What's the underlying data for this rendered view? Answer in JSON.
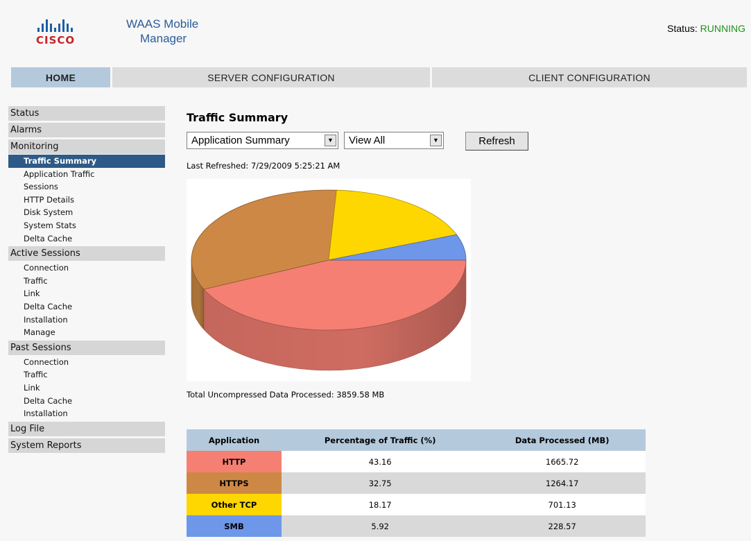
{
  "header": {
    "logo_text": "CISCO",
    "app_title_line1": "WAAS Mobile",
    "app_title_line2": "Manager",
    "status_label": "Status:",
    "status_value": "RUNNING",
    "status_color": "#1e8f1e"
  },
  "topnav": [
    {
      "label": "HOME",
      "active": true
    },
    {
      "label": "SERVER CONFIGURATION",
      "active": false
    },
    {
      "label": "CLIENT CONFIGURATION",
      "active": false
    }
  ],
  "sidebar": {
    "status": "Status",
    "alarms": "Alarms",
    "monitoring": {
      "label": "Monitoring",
      "items": [
        "Traffic Summary",
        "Application Traffic",
        "Sessions",
        "HTTP Details",
        "Disk System",
        "System Stats",
        "Delta Cache"
      ]
    },
    "active_sessions": {
      "label": "Active Sessions",
      "items": [
        "Connection",
        "Traffic",
        "Link",
        "Delta Cache",
        "Installation",
        "Manage"
      ]
    },
    "past_sessions": {
      "label": "Past Sessions",
      "items": [
        "Connection",
        "Traffic",
        "Link",
        "Delta Cache",
        "Installation"
      ]
    },
    "log_file": "Log File",
    "system_reports": "System Reports"
  },
  "main": {
    "title": "Traffic Summary",
    "select_view": "Application Summary",
    "select_filter": "View All",
    "refresh_label": "Refresh",
    "last_refreshed": "Last Refreshed: 7/29/2009 5:25:21 AM",
    "total": "Total Uncompressed Data Processed: 3859.58 MB",
    "table": {
      "headers": [
        "Application",
        "Percentage of Traffic (%)",
        "Data Processed (MB)"
      ],
      "rows": [
        {
          "app": "HTTP",
          "pct": "43.16",
          "mb": "1665.72",
          "color": "#f47f72"
        },
        {
          "app": "HTTPS",
          "pct": "32.75",
          "mb": "1264.17",
          "color": "#cc8844"
        },
        {
          "app": "Other TCP",
          "pct": "18.17",
          "mb": "701.13",
          "color": "#ffd700"
        },
        {
          "app": "SMB",
          "pct": "5.92",
          "mb": "228.57",
          "color": "#6e97ea"
        }
      ]
    }
  },
  "chart_data": {
    "type": "pie",
    "categories": [
      "HTTP",
      "HTTPS",
      "Other TCP",
      "SMB"
    ],
    "values": [
      43.16,
      32.75,
      18.17,
      5.92
    ],
    "colors": [
      "#f47f72",
      "#cc8844",
      "#ffd700",
      "#6e97ea"
    ]
  }
}
